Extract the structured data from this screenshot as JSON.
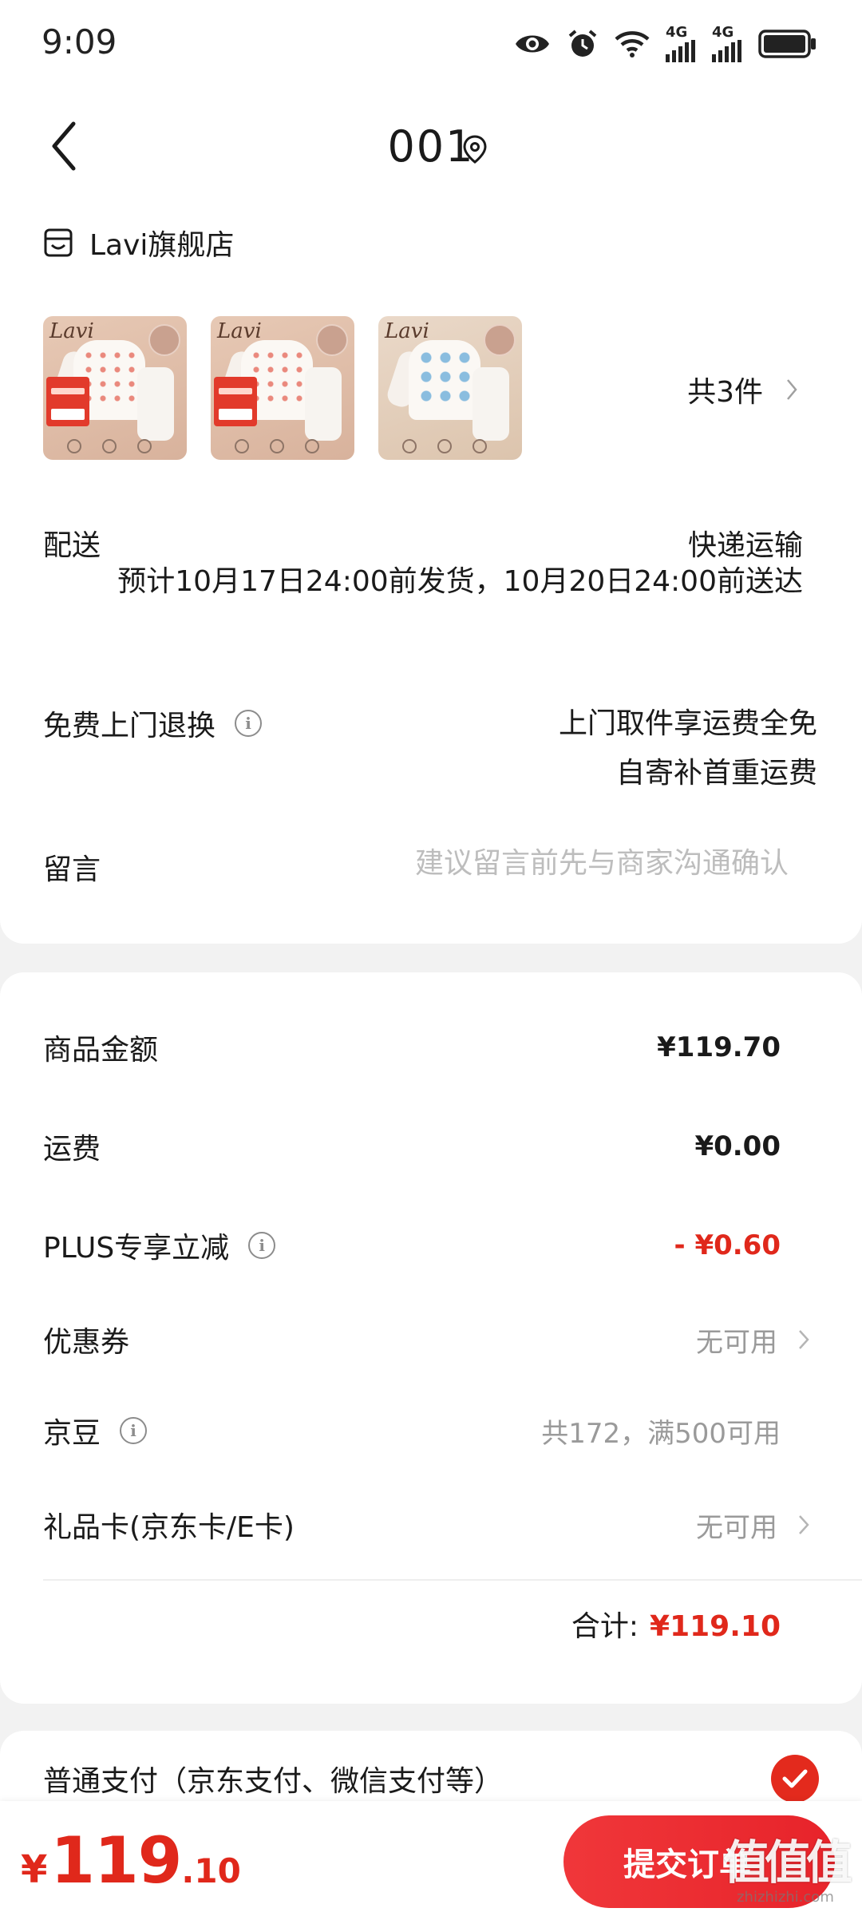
{
  "status_bar": {
    "time": "9:09",
    "network_1": "4G",
    "network_2": "4G"
  },
  "nav": {
    "title": "001"
  },
  "store": {
    "name": "Lavi旗舰店",
    "goods_brand": "Lavi",
    "goods_count": "共3件"
  },
  "delivery": {
    "label": "配送",
    "method": "快递运输",
    "eta": "预计10月17日24:00前发货，10月20日24:00前送达"
  },
  "return_service": {
    "label": "免费上门退换",
    "line1": "上门取件享运费全免",
    "line2": "自寄补首重运费"
  },
  "message": {
    "label": "留言",
    "placeholder": "建议留言前先与商家沟通确认"
  },
  "price": {
    "goods_amount_label": "商品金额",
    "goods_amount": "¥119.70",
    "shipping_label": "运费",
    "shipping": "¥0.00",
    "plus_label": "PLUS专享立减",
    "plus_discount": "- ¥0.60",
    "coupon_label": "优惠券",
    "coupon_value": "无可用",
    "jingdou_label": "京豆",
    "jingdou_value": "共172，满500可用",
    "giftcard_label": "礼品卡(京东卡/E卡)",
    "giftcard_value": "无可用",
    "total_label": "合计:",
    "total_value": "¥119.10"
  },
  "payment": {
    "label": "普通支付（京东支付、微信支付等）"
  },
  "bottom": {
    "currency": "¥",
    "total_int": "119",
    "total_dec": ".10",
    "submit_label": "提交订单"
  },
  "watermark": {
    "logo": "值值值",
    "text": "zhizhizhi.com"
  },
  "colors": {
    "accent_red": "#e0281b",
    "text_primary": "#1a1a1a",
    "text_muted": "#9a9a9a",
    "page_bg": "#f2f2f2"
  },
  "icons": {
    "back": "chevron-left-icon",
    "location": "location-pin-icon",
    "store": "store-icon",
    "info": "info-icon",
    "chevron": "chevron-right-icon",
    "check": "check-icon"
  }
}
